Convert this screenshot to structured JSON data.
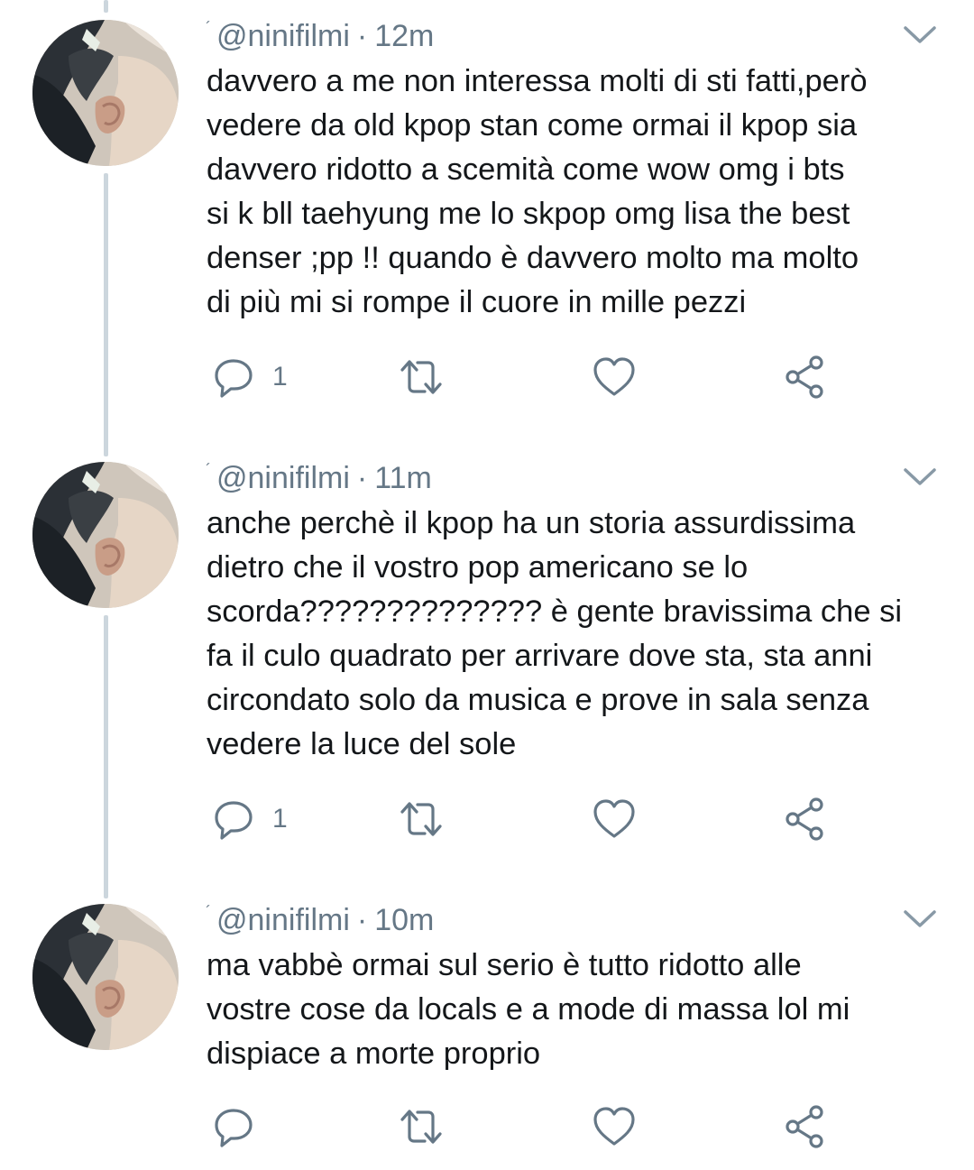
{
  "tweets": [
    {
      "handle": "@ninifilmi",
      "separator": "·",
      "time": "12m",
      "lines": [
        "davvero a me non interessa molti di sti fatti,però",
        "vedere da old kpop stan come ormai il kpop sia",
        "davvero ridotto a scemità come wow omg  i bts",
        "si k bll taehyung me lo skpop omg lisa the best",
        "denser ;pp !! quando è davvero molto ma molto",
        "di più mi si rompe il cuore in mille pezzi"
      ],
      "reply_count": "1"
    },
    {
      "handle": "@ninifilmi",
      "separator": "·",
      "time": "11m",
      "lines": [
        "anche perchè il kpop ha un storia assurdissima",
        "dietro che il vostro pop americano se lo",
        "scorda?????????????? è gente bravissima che si",
        "fa il culo quadrato per arrivare dove sta, sta anni",
        "circondato solo da musica e prove in sala senza",
        "vedere la luce del sole"
      ],
      "reply_count": "1"
    },
    {
      "handle": "@ninifilmi",
      "separator": "·",
      "time": "10m",
      "lines": [
        "ma vabbè ormai sul serio è tutto ridotto alle",
        "vostre cose da locals e a mode di massa lol mi",
        "dispiace a morte proprio"
      ],
      "reply_count": ""
    }
  ],
  "icons": {
    "reply": "reply-icon",
    "retweet": "retweet-icon",
    "like": "like-icon",
    "share": "share-icon",
    "menu": "chevron-down-icon"
  },
  "colors": {
    "icon_gray": "#657786",
    "text": "#14171a",
    "thread_line": "#ccd6dd"
  }
}
